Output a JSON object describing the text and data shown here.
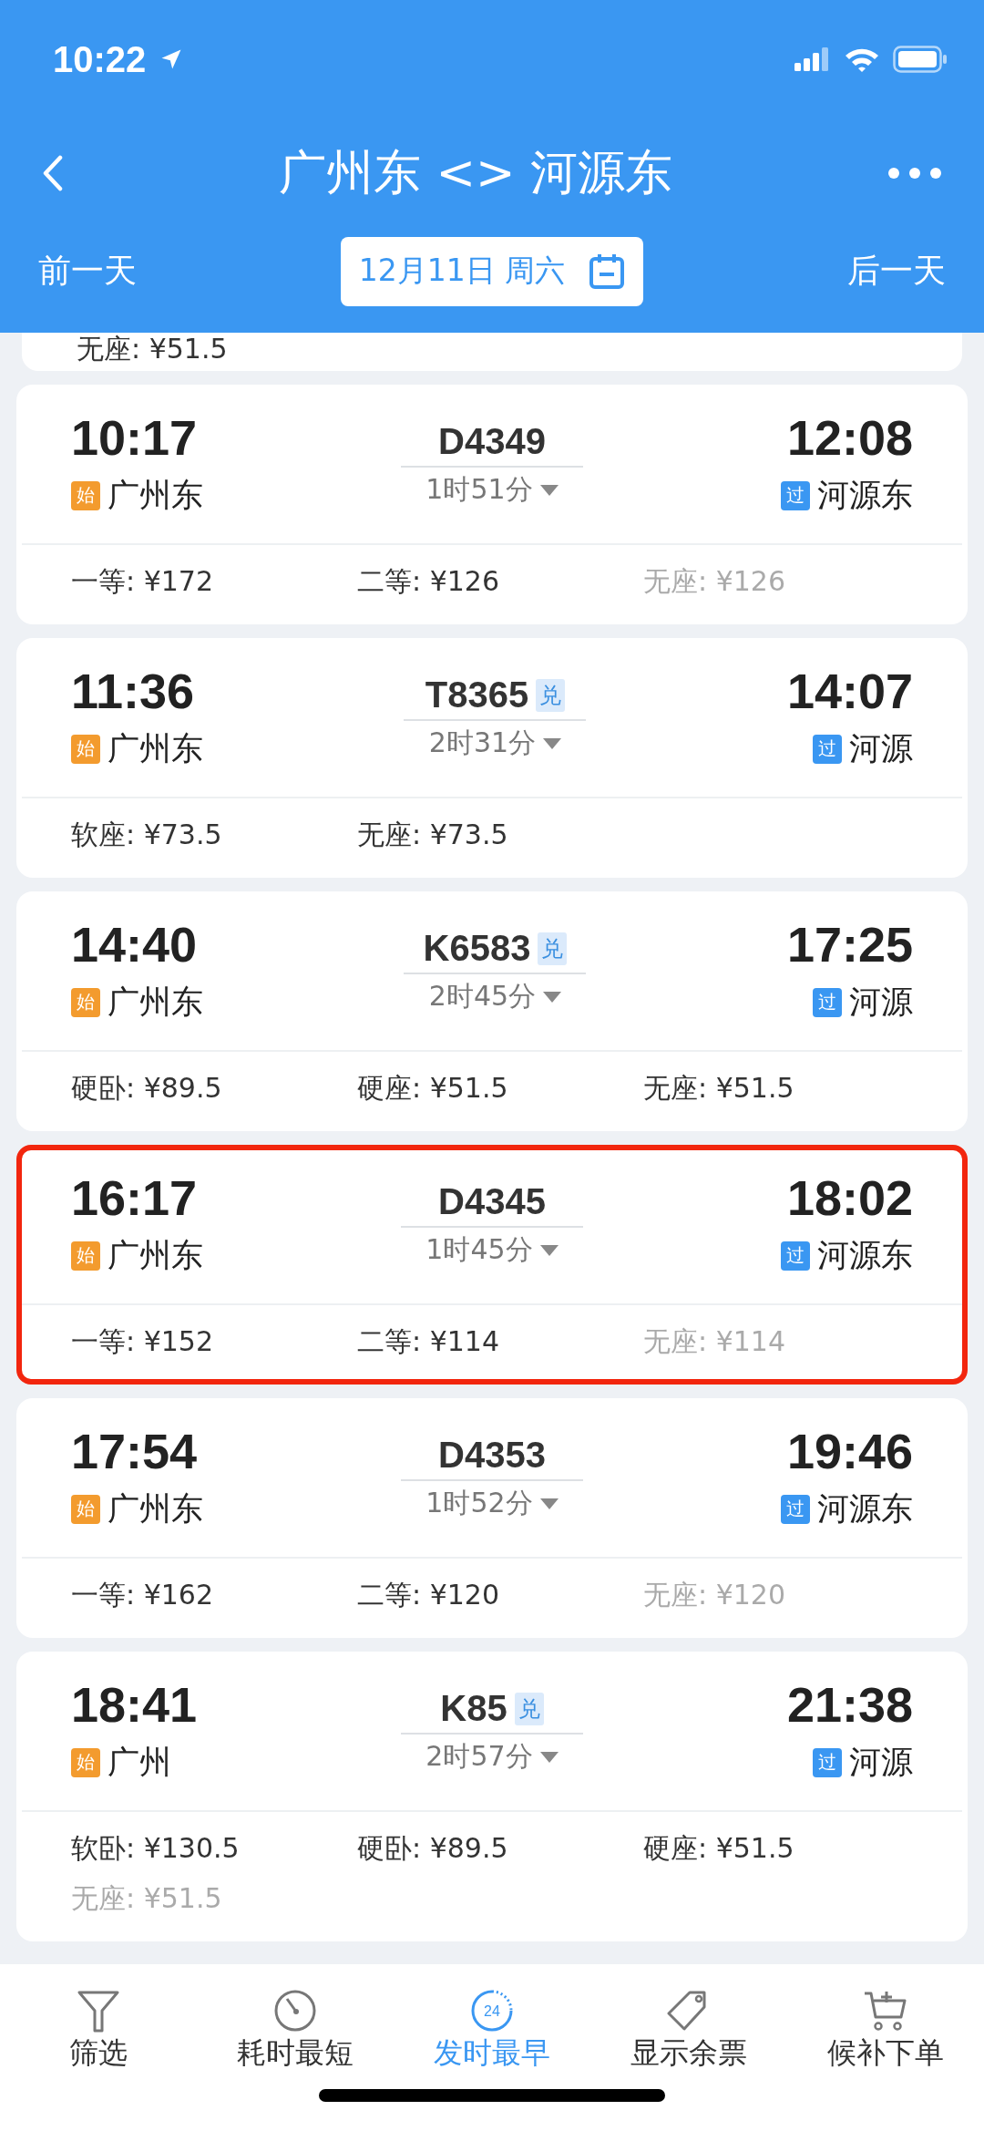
{
  "status_bar": {
    "time": "10:22"
  },
  "nav": {
    "title": "广州东 <> 河源东"
  },
  "date_bar": {
    "prev": "前一天",
    "date": "12月11日 周六",
    "next": "后一天"
  },
  "partial_prices": [
    {
      "label": "无座: ¥51.5",
      "available": true
    }
  ],
  "trains": [
    {
      "depart": "10:17",
      "from_tag": "始",
      "from": "广州东",
      "number": "D4349",
      "duration": "1时51分",
      "arrive": "12:08",
      "to_tag": "过",
      "to": "河源东",
      "highlighted": false,
      "prices": [
        {
          "label": "一等: ¥172",
          "available": true
        },
        {
          "label": "二等: ¥126",
          "available": true
        },
        {
          "label": "无座: ¥126",
          "available": false
        }
      ]
    },
    {
      "depart": "11:36",
      "from_tag": "始",
      "from": "广州东",
      "number": "T8365",
      "exchange": "兑",
      "duration": "2时31分",
      "arrive": "14:07",
      "to_tag": "过",
      "to": "河源",
      "highlighted": false,
      "prices": [
        {
          "label": "软座: ¥73.5",
          "available": true
        },
        {
          "label": "无座: ¥73.5",
          "available": true
        }
      ]
    },
    {
      "depart": "14:40",
      "from_tag": "始",
      "from": "广州东",
      "number": "K6583",
      "exchange": "兑",
      "duration": "2时45分",
      "arrive": "17:25",
      "to_tag": "过",
      "to": "河源",
      "highlighted": false,
      "prices": [
        {
          "label": "硬卧: ¥89.5",
          "available": true
        },
        {
          "label": "硬座: ¥51.5",
          "available": true
        },
        {
          "label": "无座: ¥51.5",
          "available": true
        }
      ]
    },
    {
      "depart": "16:17",
      "from_tag": "始",
      "from": "广州东",
      "number": "D4345",
      "duration": "1时45分",
      "arrive": "18:02",
      "to_tag": "过",
      "to": "河源东",
      "highlighted": true,
      "prices": [
        {
          "label": "一等: ¥152",
          "available": true
        },
        {
          "label": "二等: ¥114",
          "available": true
        },
        {
          "label": "无座: ¥114",
          "available": false
        }
      ]
    },
    {
      "depart": "17:54",
      "from_tag": "始",
      "from": "广州东",
      "number": "D4353",
      "duration": "1时52分",
      "arrive": "19:46",
      "to_tag": "过",
      "to": "河源东",
      "highlighted": false,
      "prices": [
        {
          "label": "一等: ¥162",
          "available": true
        },
        {
          "label": "二等: ¥120",
          "available": true
        },
        {
          "label": "无座: ¥120",
          "available": false
        }
      ]
    },
    {
      "depart": "18:41",
      "from_tag": "始",
      "from": "广州",
      "number": "K85",
      "exchange": "兑",
      "duration": "2时57分",
      "arrive": "21:38",
      "to_tag": "过",
      "to": "河源",
      "highlighted": false,
      "prices": [
        {
          "label": "软卧: ¥130.5",
          "available": true
        },
        {
          "label": "硬卧: ¥89.5",
          "available": true
        },
        {
          "label": "硬座: ¥51.5",
          "available": true
        },
        {
          "label": "无座: ¥51.5",
          "available": false
        }
      ]
    }
  ],
  "tab_bar": [
    {
      "kind": "filter",
      "label": "筛选",
      "selected": false
    },
    {
      "kind": "timer",
      "label": "耗时最短",
      "selected": false
    },
    {
      "kind": "clock24",
      "label": "发时最早",
      "icon_text": "24",
      "selected": true
    },
    {
      "kind": "tag",
      "label": "显示余票",
      "selected": false
    },
    {
      "kind": "cart",
      "label": "候补下单",
      "selected": false
    }
  ]
}
